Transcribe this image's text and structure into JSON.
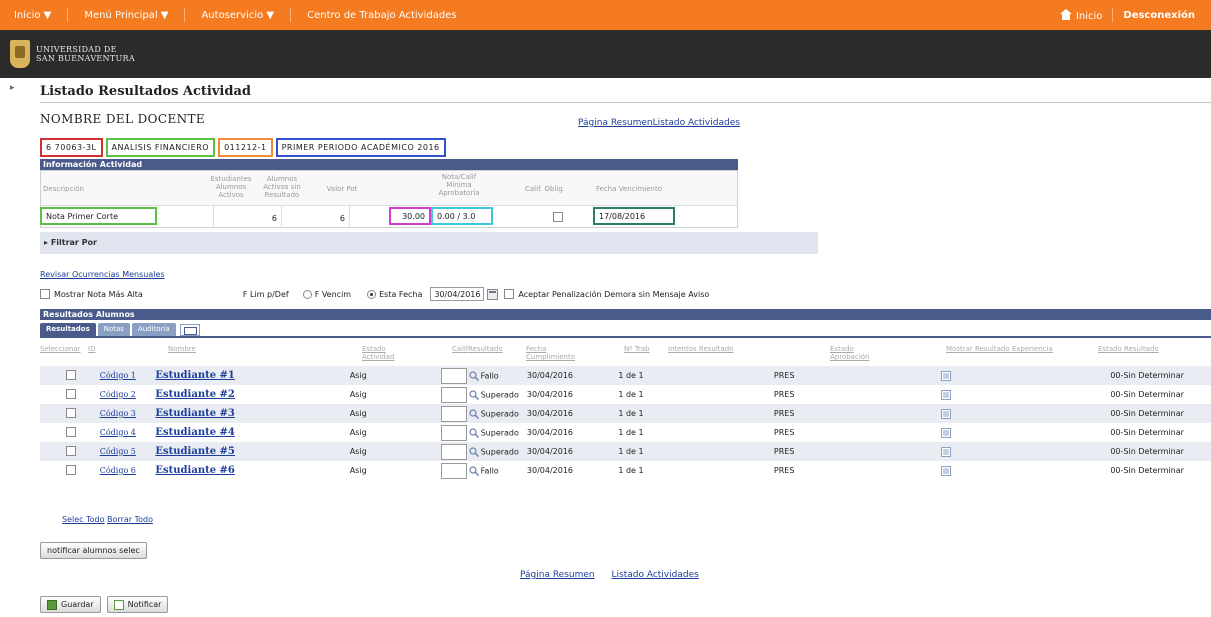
{
  "topnav": {
    "items": [
      "Inicio ▼",
      "Menú Principal ▼",
      "Autoservicio ▼",
      "Centro de Trabajo Actividades"
    ],
    "home": "Inicio",
    "logout": "Desconexión"
  },
  "brand": {
    "line1": "UNIVERSIDAD DE",
    "line2": "SAN BUENAVENTURA"
  },
  "page": {
    "title": "Listado Resultados Actividad",
    "docente": "NOMBRE DEL DOCENTE"
  },
  "links": {
    "resumen": "Página Resumen",
    "listado": "Listado Actividades"
  },
  "course": {
    "code": "6 70063-3L",
    "name": "ANALISIS FINANCIERO",
    "number": "011212-1",
    "period": "PRIMER PERIODO ACADÉMICO 2016"
  },
  "info": {
    "header": "Información Actividad",
    "cols": [
      "Descripción",
      "Estudiantes Alumnos Activos",
      "Alumnos Activos sin Resultado",
      "Valor Pot",
      "Nota/Calif Mínima Aprobatoria",
      "Calif. Oblig.",
      "Fecha Vencimiento"
    ],
    "descripcion": "Nota Primer Corte",
    "alumnos": "6",
    "sin_resultado": "6",
    "valor": "30.00",
    "minima": "0.00 / 3.0",
    "fecha": "17/08/2016"
  },
  "filter": {
    "label": "Filtrar Por"
  },
  "review": "Revisar Ocurrencias Mensuales",
  "options": {
    "mostrar": "Mostrar Nota Más Alta",
    "flim": "F Lim p/Def",
    "fvenc": "F Vencim",
    "esta_fecha": "Esta Fecha",
    "fecha": "30/04/2016",
    "aceptar": "Aceptar Penalización Demora sin Mensaje Aviso"
  },
  "results": {
    "header": "Resultados Alumnos",
    "tabs": [
      "Resultados",
      "Notas",
      "Auditoría"
    ],
    "cols": [
      "Seleccionar",
      "ID",
      "Nombre",
      "Estado Actividad",
      "Calif",
      "Resultado",
      "Fecha Cumplimiento",
      "Nº Trab",
      "Intentos Resultado",
      "Estado Aprobación",
      "Mostrar Resultado Experiencia",
      "Estado Resultado"
    ],
    "rows": [
      {
        "code": "Código 1",
        "name": "Estudiante #1",
        "estado": "Asig",
        "resultado": "Fallo",
        "fecha": "30/04/2016",
        "intentos": "1 de 1",
        "aprob": "PRES",
        "estado_res": "00-Sin Determinar"
      },
      {
        "code": "Código 2",
        "name": "Estudiante #2",
        "estado": "Asig",
        "resultado": "Superado",
        "fecha": "30/04/2016",
        "intentos": "1 de 1",
        "aprob": "PRES",
        "estado_res": "00-Sin Determinar"
      },
      {
        "code": "Código 3",
        "name": "Estudiante #3",
        "estado": "Asig",
        "resultado": "Superado",
        "fecha": "30/04/2016",
        "intentos": "1 de 1",
        "aprob": "PRES",
        "estado_res": "00-Sin Determinar"
      },
      {
        "code": "Código 4",
        "name": "Estudiante #4",
        "estado": "Asig",
        "resultado": "Superado",
        "fecha": "30/04/2016",
        "intentos": "1 de 1",
        "aprob": "PRES",
        "estado_res": "00-Sin Determinar"
      },
      {
        "code": "Código 5",
        "name": "Estudiante #5",
        "estado": "Asig",
        "resultado": "Superado",
        "fecha": "30/04/2016",
        "intentos": "1 de 1",
        "aprob": "PRES",
        "estado_res": "00-Sin Determinar"
      },
      {
        "code": "Código 6",
        "name": "Estudiante #6",
        "estado": "Asig",
        "resultado": "Fallo",
        "fecha": "30/04/2016",
        "intentos": "1 de 1",
        "aprob": "PRES",
        "estado_res": "00-Sin Determinar"
      }
    ]
  },
  "select_links": {
    "all": "Selec Todo",
    "none": "Borrar Todo"
  },
  "buttons": {
    "notificar_selec": "notificar alumnos selec",
    "guardar": "Guardar",
    "notificar": "Notificar"
  },
  "colors": {
    "orange": "#f47b20",
    "navy": "#4a5a8a",
    "link": "#1b3e9a"
  }
}
